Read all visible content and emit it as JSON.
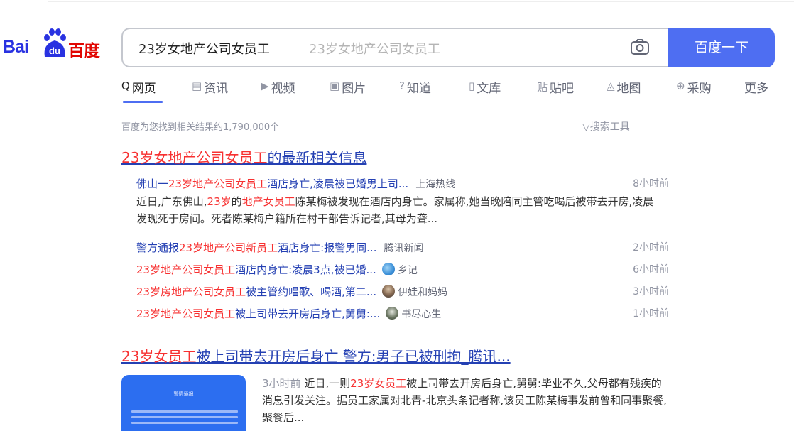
{
  "logo": {
    "bai": "Bai",
    "du": "du",
    "cn": "百度"
  },
  "search": {
    "query": "23岁女地产公司女员工",
    "suggestion": "23岁女地产公司女员工",
    "button": "百度一下"
  },
  "tabs": [
    {
      "label": "网页",
      "icon": "Q"
    },
    {
      "label": "资讯",
      "icon": "▤"
    },
    {
      "label": "视频",
      "icon": "▶"
    },
    {
      "label": "图片",
      "icon": "▣"
    },
    {
      "label": "知道",
      "icon": "?"
    },
    {
      "label": "文库",
      "icon": "▯"
    },
    {
      "label": "贴吧",
      "icon": "贴"
    },
    {
      "label": "地图",
      "icon": "◬"
    },
    {
      "label": "采购",
      "icon": "⊕"
    },
    {
      "label": "更多",
      "icon": ""
    }
  ],
  "result_count": "百度为您找到相关结果约1,790,000个",
  "search_tools": "搜索工具",
  "result1": {
    "title_hl": "23岁女地产公司女员工",
    "title_rest": "的最新相关信息",
    "news": [
      {
        "p1": "佛山一",
        "h1": "23岁地产公司女员工",
        "p2": "酒店身亡,凌晨被已婚男上司...",
        "source": "上海热线",
        "time": "8小时前"
      },
      {
        "p1": "警方通报",
        "h1": "23岁地产公司新员工",
        "p2": "酒店身亡:报警男同...",
        "source": "腾讯新闻",
        "time": "2小时前"
      },
      {
        "p1": "",
        "h1": "23岁地产公司女员工",
        "p2": "酒店内身亡:凌晨3点,被已婚...",
        "source": "乡记",
        "time": "6小时前"
      },
      {
        "p1": "",
        "h1": "23岁房地产公司女员工",
        "p2": "被主管约唱歌、喝酒,第二...",
        "source": "伊娃和妈妈",
        "time": "3小时前"
      },
      {
        "p1": "",
        "h1": "23岁地产公司女员工",
        "p2": "被上司带去开房后身亡,舅舅:...",
        "source": "书尽心生",
        "time": "1小时前"
      }
    ],
    "abstract": {
      "a1": "近日,广东佛山,",
      "h1": "23岁",
      "a2": "的",
      "h2": "地产女员工",
      "a3": "陈某梅被发现在酒店内身亡。家属称,她当晚陪同主管吃喝后被带去开房,凌晨发现死于房间。死者陈某梅户籍所在村干部告诉记者,其母为聋..."
    }
  },
  "result2": {
    "title_hl": "23岁女员工",
    "title_rest": "被上司带去开房后身亡 警方:男子已被刑拘_腾讯...",
    "thumb_title": "警情通报",
    "time": "3小时前",
    "a1": "近日,一则",
    "h1": "23岁女员工",
    "a2": "被上司带去开房后身亡,舅舅:毕业不久,父母都有残疾的消息引发关注。据员工家属对北青-北京头条记者称,该员工陈某梅事发前曾和同事聚餐,聚餐后..."
  },
  "colors": {
    "accent": "#4e6ef2",
    "link": "#2440b3",
    "highlight": "#f73131",
    "logo_blue": "#2932e1",
    "logo_red": "#e10601"
  }
}
